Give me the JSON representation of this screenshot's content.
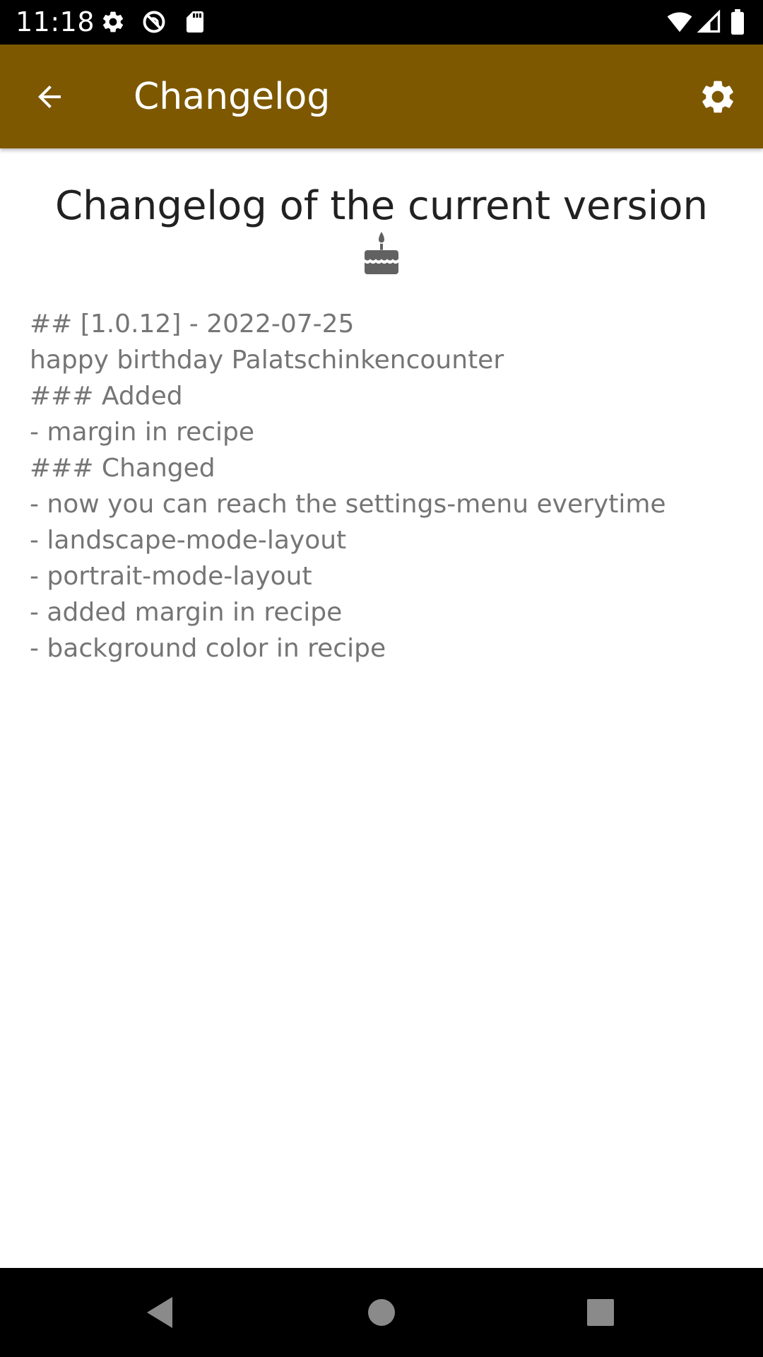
{
  "status_bar": {
    "time": "11:18",
    "left_icons": [
      "gear-icon",
      "do-not-disturb-icon",
      "sd-card-icon"
    ],
    "right_icons": [
      "wifi-icon",
      "signal-icon",
      "battery-icon"
    ]
  },
  "app_bar": {
    "title": "Changelog",
    "background_color": "#7D5800",
    "back_icon": "arrow-back-icon",
    "settings_icon": "gear-icon"
  },
  "content": {
    "heading": "Changelog of the current version",
    "heading_icon": "cake-icon",
    "changelog_lines": [
      "## [1.0.12] - 2022-07-25",
      "happy birthday Palatschinkencounter",
      "### Added",
      "- margin in recipe",
      "### Changed",
      "- now you can reach the settings-menu everytime",
      "- landscape-mode-layout",
      "- portrait-mode-layout",
      "- added margin in recipe",
      "- background color in recipe"
    ]
  },
  "nav_bar": {
    "buttons": [
      "back-triangle-icon",
      "home-circle-icon",
      "recents-square-icon"
    ]
  }
}
